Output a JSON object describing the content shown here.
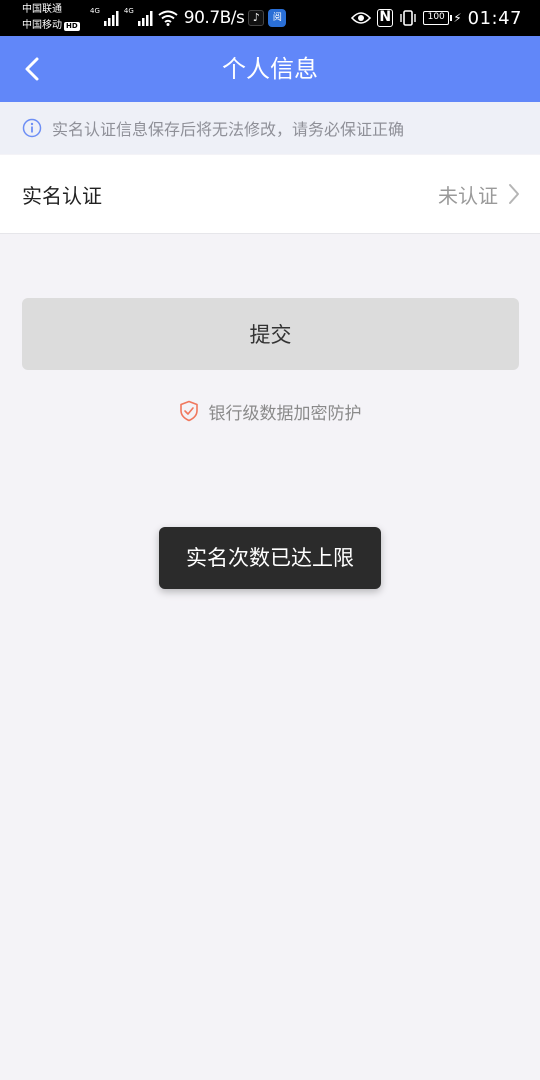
{
  "status_bar": {
    "carrier1": "中国联通",
    "carrier2": "中国移动",
    "hd_badge": "HD",
    "net1": "4G",
    "net2": "4G",
    "speed": "90.7B/s",
    "tiktok_glyph": "♪",
    "app_glyph": "阅",
    "nfc": "N",
    "battery": "100",
    "time": "01:47"
  },
  "header": {
    "title": "个人信息"
  },
  "notice": {
    "text": "实名认证信息保存后将无法修改，请务必保证正确",
    "icon": "info-circle-icon"
  },
  "verify_row": {
    "label": "实名认证",
    "status": "未认证"
  },
  "submit": {
    "label": "提交"
  },
  "security": {
    "text": "银行级数据加密防护",
    "icon": "shield-check-icon"
  },
  "toast": {
    "text": "实名次数已达上限"
  },
  "colors": {
    "header_bg": "#6187f9",
    "page_bg": "#f4f3f7",
    "notice_icon": "#6d8ef5",
    "shield": "#f0775d",
    "button_bg": "#dcdcdc",
    "toast_bg": "#2b2b2b"
  }
}
